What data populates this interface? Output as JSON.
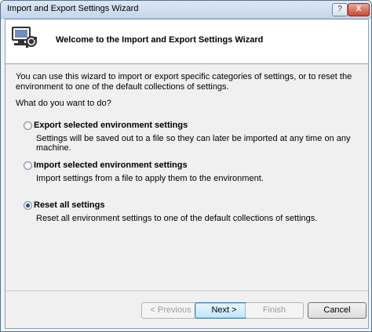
{
  "window": {
    "title": "Import and Export Settings Wizard",
    "help_label": "?",
    "close_label": "X"
  },
  "header": {
    "title": "Welcome to the Import and Export Settings Wizard",
    "icon": "wizard-computer-icon"
  },
  "main": {
    "intro": "You can use this wizard to import or export specific categories of settings, or to reset the environment to one of the default collections of settings.",
    "question": "What do you want to do?",
    "options": [
      {
        "label": "Export selected environment settings",
        "description": "Settings will be saved out to a file so they can later be imported at any time on any machine.",
        "selected": false
      },
      {
        "label": "Import selected environment settings",
        "description": "Import settings from a file to apply them to the environment.",
        "selected": false
      },
      {
        "label": "Reset all settings",
        "description": "Reset all environment settings to one of the default collections of settings.",
        "selected": true
      }
    ]
  },
  "buttons": {
    "previous": "< Previous",
    "next": "Next >",
    "finish": "Finish",
    "cancel": "Cancel"
  }
}
